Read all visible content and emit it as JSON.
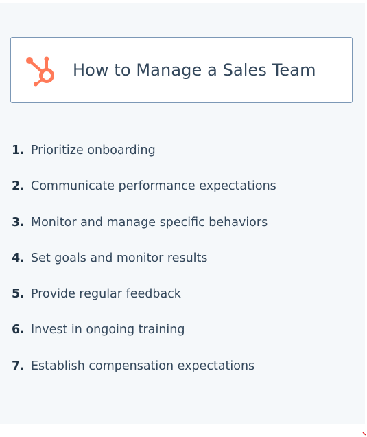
{
  "title_card": {
    "title": "How to Manage a Sales Team",
    "logo_icon": "hubspot-sprocket-icon",
    "logo_color": "#ff7a59"
  },
  "items": [
    {
      "number": "1.",
      "text": "Prioritize onboarding"
    },
    {
      "number": "2.",
      "text": "Communicate performance expectations"
    },
    {
      "number": "3.",
      "text": "Monitor and manage specific behaviors"
    },
    {
      "number": "4.",
      "text": "Set goals and monitor results"
    },
    {
      "number": "5.",
      "text": "Provide regular feedback"
    },
    {
      "number": "6.",
      "text": "Invest in ongoing training"
    },
    {
      "number": "7.",
      "text": "Establish compensation expectations"
    }
  ],
  "colors": {
    "panel_bg": "#f5f8fa",
    "text": "#33475b",
    "card_border": "#7c98b6",
    "accent": "#ff7a59"
  }
}
